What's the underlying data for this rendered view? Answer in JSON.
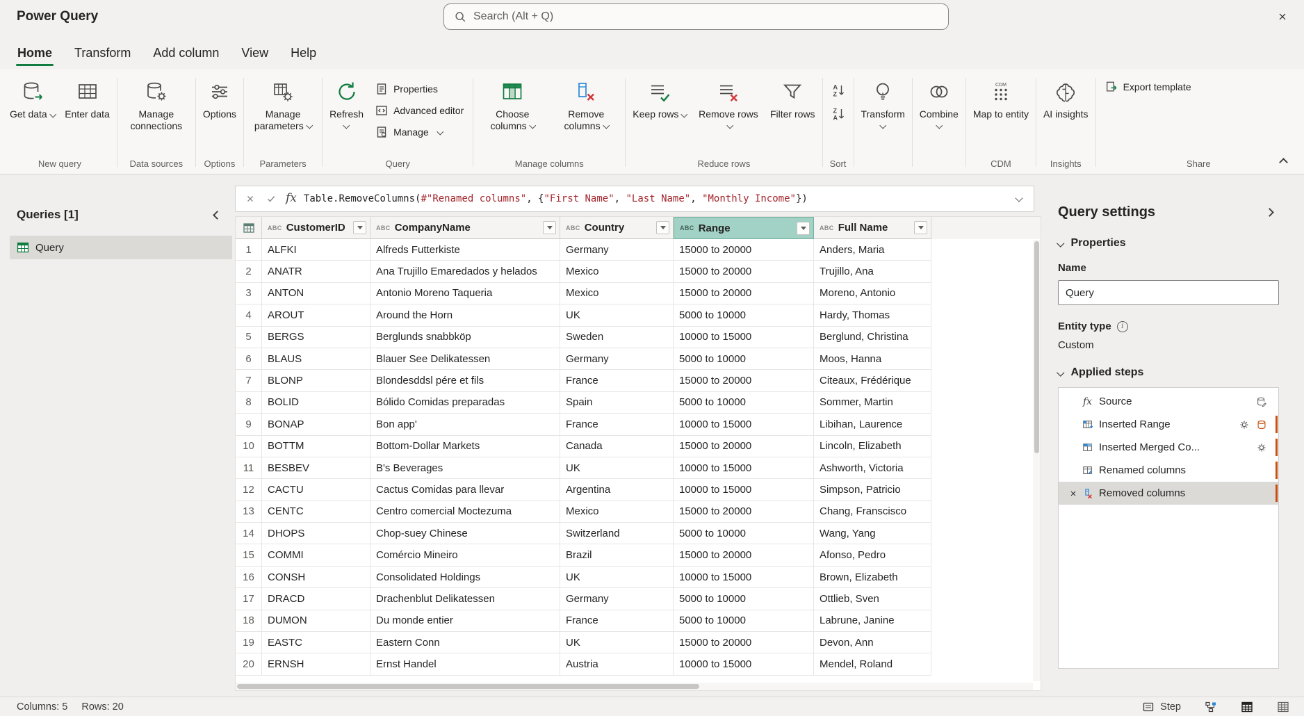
{
  "app": {
    "title": "Power Query"
  },
  "titlebar": {
    "search_placeholder": "Search (Alt + Q)"
  },
  "menu": {
    "tabs": [
      {
        "label": "Home",
        "active": true
      },
      {
        "label": "Transform",
        "active": false
      },
      {
        "label": "Add column",
        "active": false
      },
      {
        "label": "View",
        "active": false
      },
      {
        "label": "Help",
        "active": false
      }
    ]
  },
  "ribbon": {
    "buttons": {
      "get_data": "Get data",
      "enter_data": "Enter data",
      "manage_connections": "Manage connections",
      "options": "Options",
      "manage_parameters": "Manage parameters",
      "refresh": "Refresh",
      "properties": "Properties",
      "advanced_editor": "Advanced editor",
      "manage": "Manage",
      "choose_columns": "Choose columns",
      "remove_columns": "Remove columns",
      "keep_rows": "Keep rows",
      "remove_rows": "Remove rows",
      "filter_rows": "Filter rows",
      "transform": "Transform",
      "combine": "Combine",
      "map_to_entity": "Map to entity",
      "ai_insights": "AI insights",
      "export_template": "Export template"
    },
    "groups": {
      "new_query": "New query",
      "data_sources": "Data sources",
      "options": "Options",
      "parameters": "Parameters",
      "query": "Query",
      "manage_columns": "Manage columns",
      "reduce_rows": "Reduce rows",
      "sort": "Sort",
      "cdm": "CDM",
      "insights": "Insights",
      "share": "Share"
    }
  },
  "queries_panel": {
    "title": "Queries [1]",
    "items": [
      {
        "label": "Query",
        "selected": true
      }
    ]
  },
  "formula": {
    "parts": [
      {
        "kind": "plain",
        "text": "Table.RemoveColumns("
      },
      {
        "kind": "string",
        "text": "#\"Renamed columns\""
      },
      {
        "kind": "plain",
        "text": ", {"
      },
      {
        "kind": "string",
        "text": "\"First Name\""
      },
      {
        "kind": "plain",
        "text": ", "
      },
      {
        "kind": "string",
        "text": "\"Last Name\""
      },
      {
        "kind": "plain",
        "text": ", "
      },
      {
        "kind": "string",
        "text": "\"Monthly Income\""
      },
      {
        "kind": "plain",
        "text": "})"
      }
    ]
  },
  "glyphs": {
    "abc": "ABC",
    "fx": "fx"
  },
  "table": {
    "columns": [
      {
        "name": "CustomerID",
        "type": "text",
        "selected": false
      },
      {
        "name": "CompanyName",
        "type": "text",
        "selected": false
      },
      {
        "name": "Country",
        "type": "text",
        "selected": false
      },
      {
        "name": "Range",
        "type": "text",
        "selected": true
      },
      {
        "name": "Full Name",
        "type": "text",
        "selected": false
      }
    ],
    "rows": [
      {
        "num": "1",
        "cells": [
          "ALFKI",
          "Alfreds Futterkiste",
          "Germany",
          "15000 to 20000",
          "Anders, Maria"
        ]
      },
      {
        "num": "2",
        "cells": [
          "ANATR",
          "Ana Trujillo Emaredados y helados",
          "Mexico",
          "15000 to 20000",
          "Trujillo, Ana"
        ]
      },
      {
        "num": "3",
        "cells": [
          "ANTON",
          "Antonio Moreno Taqueria",
          "Mexico",
          "15000 to 20000",
          "Moreno, Antonio"
        ]
      },
      {
        "num": "4",
        "cells": [
          "AROUT",
          "Around the Horn",
          "UK",
          "5000 to 10000",
          "Hardy, Thomas"
        ]
      },
      {
        "num": "5",
        "cells": [
          "BERGS",
          "Berglunds snabbköp",
          "Sweden",
          "10000 to 15000",
          "Berglund, Christina"
        ]
      },
      {
        "num": "6",
        "cells": [
          "BLAUS",
          "Blauer See Delikatessen",
          "Germany",
          "5000 to 10000",
          "Moos, Hanna"
        ]
      },
      {
        "num": "7",
        "cells": [
          "BLONP",
          "Blondesddsl pére et fils",
          "France",
          "15000 to 20000",
          "Citeaux, Frédérique"
        ]
      },
      {
        "num": "8",
        "cells": [
          "BOLID",
          "Bólido Comidas preparadas",
          "Spain",
          "5000 to 10000",
          "Sommer, Martin"
        ]
      },
      {
        "num": "9",
        "cells": [
          "BONAP",
          "Bon app'",
          "France",
          "10000 to 15000",
          "Libihan, Laurence"
        ]
      },
      {
        "num": "10",
        "cells": [
          "BOTTM",
          "Bottom-Dollar Markets",
          "Canada",
          "15000 to 20000",
          "Lincoln, Elizabeth"
        ]
      },
      {
        "num": "11",
        "cells": [
          "BESBEV",
          "B's Beverages",
          "UK",
          "10000 to 15000",
          "Ashworth, Victoria"
        ]
      },
      {
        "num": "12",
        "cells": [
          "CACTU",
          "Cactus Comidas para llevar",
          "Argentina",
          "10000 to 15000",
          "Simpson, Patricio"
        ]
      },
      {
        "num": "13",
        "cells": [
          "CENTC",
          "Centro comercial Moctezuma",
          "Mexico",
          "15000 to 20000",
          "Chang, Franscisco"
        ]
      },
      {
        "num": "14",
        "cells": [
          "DHOPS",
          "Chop-suey Chinese",
          "Switzerland",
          "5000 to 10000",
          "Wang, Yang"
        ]
      },
      {
        "num": "15",
        "cells": [
          "COMMI",
          "Comércio Mineiro",
          "Brazil",
          "15000 to 20000",
          "Afonso, Pedro"
        ]
      },
      {
        "num": "16",
        "cells": [
          "CONSH",
          "Consolidated Holdings",
          "UK",
          "10000 to 15000",
          "Brown, Elizabeth"
        ]
      },
      {
        "num": "17",
        "cells": [
          "DRACD",
          "Drachenblut Delikatessen",
          "Germany",
          "5000 to 10000",
          "Ottlieb, Sven"
        ]
      },
      {
        "num": "18",
        "cells": [
          "DUMON",
          "Du monde entier",
          "France",
          "5000 to 10000",
          "Labrune, Janine"
        ]
      },
      {
        "num": "19",
        "cells": [
          "EASTC",
          "Eastern Conn",
          "UK",
          "15000 to 20000",
          "Devon, Ann"
        ]
      },
      {
        "num": "20",
        "cells": [
          "ERNSH",
          "Ernst Handel",
          "Austria",
          "10000 to 15000",
          "Mendel, Roland"
        ]
      }
    ]
  },
  "query_settings": {
    "title": "Query settings",
    "properties_header": "Properties",
    "name_label": "Name",
    "name_value": "Query",
    "entity_type_label": "Entity type",
    "entity_type_value": "Custom",
    "applied_steps_header": "Applied steps",
    "steps": [
      {
        "label": "Source",
        "selected": false
      },
      {
        "label": "Inserted Range",
        "selected": false
      },
      {
        "label": "Inserted Merged Co...",
        "selected": false
      },
      {
        "label": "Renamed columns",
        "selected": false
      },
      {
        "label": "Removed columns",
        "selected": true
      }
    ]
  },
  "statusbar": {
    "columns_info": "Columns: 5",
    "rows_info": "Rows: 20",
    "step_label": "Step"
  },
  "colors": {
    "accent_green": "#107c41",
    "selected_column_header": "#a2d2c5",
    "string_literal": "#a4262c",
    "step_marker_orange": "#ca5010"
  }
}
